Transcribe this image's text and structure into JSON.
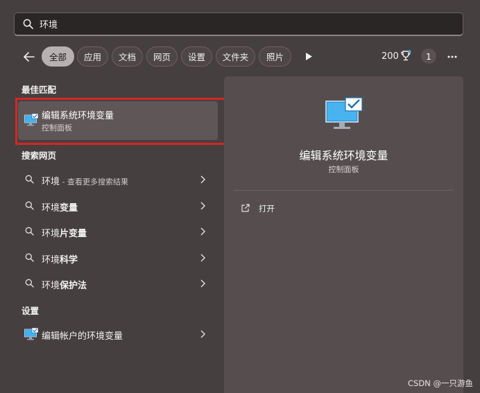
{
  "search": {
    "query": "环境"
  },
  "filters": {
    "chips": [
      {
        "label": "全部",
        "active": true
      },
      {
        "label": "应用",
        "active": false
      },
      {
        "label": "文档",
        "active": false
      },
      {
        "label": "网页",
        "active": false
      },
      {
        "label": "设置",
        "active": false
      },
      {
        "label": "文件夹",
        "active": false
      },
      {
        "label": "照片",
        "active": false
      }
    ],
    "points": "200",
    "badge": "1"
  },
  "best_match": {
    "section_title": "最佳匹配",
    "title": "编辑系统环境变量",
    "subtitle": "控制面板"
  },
  "web_search": {
    "section_title": "搜索网页",
    "items": [
      {
        "prefix": "环境",
        "bold": "",
        "hint": " - 查看更多搜索结果"
      },
      {
        "prefix": "环境",
        "bold": "变量",
        "hint": ""
      },
      {
        "prefix": "环境",
        "bold": "片变量",
        "hint": ""
      },
      {
        "prefix": "环境",
        "bold": "科学",
        "hint": ""
      },
      {
        "prefix": "环境",
        "bold": "保护法",
        "hint": ""
      }
    ]
  },
  "settings": {
    "section_title": "设置",
    "items": [
      {
        "label": "编辑帐户的环境变量"
      }
    ]
  },
  "preview": {
    "title": "编辑系统环境变量",
    "subtitle": "控制面板",
    "open_label": "打开"
  },
  "watermark": "CSDN @一只游鱼",
  "colors": {
    "background": "#463f3f",
    "panel": "#564e4e",
    "selected": "#5f5757",
    "highlight_border": "#d52626",
    "active_chip": "#b8b1b1"
  }
}
